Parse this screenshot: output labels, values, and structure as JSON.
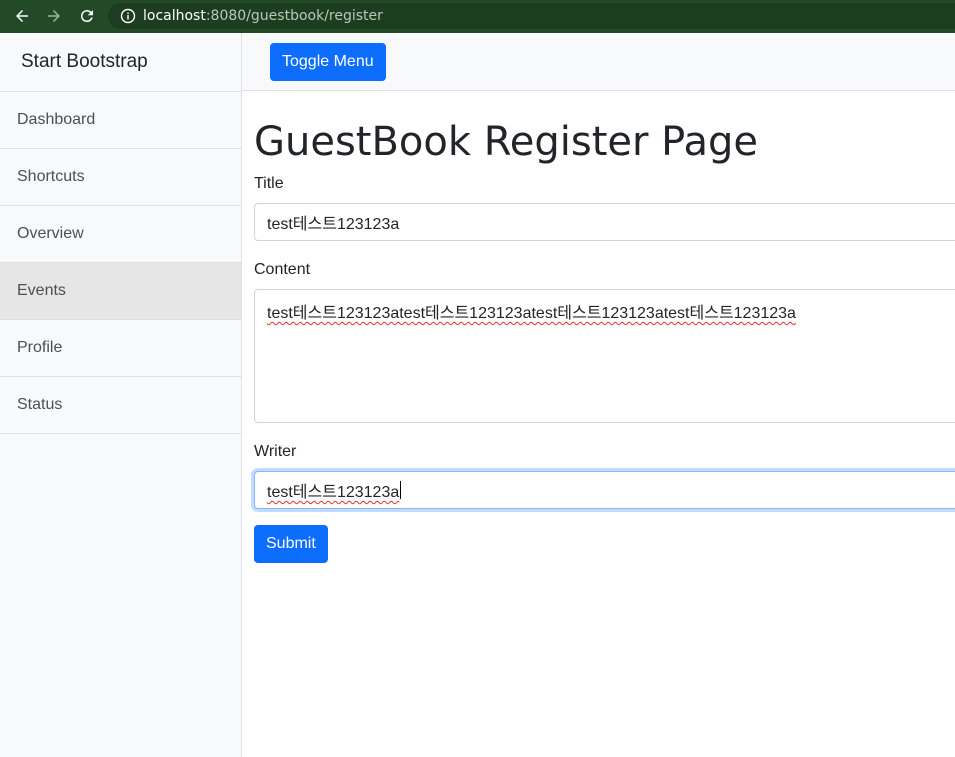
{
  "browser": {
    "url_host": "localhost",
    "url_rest": ":8080/guestbook/register"
  },
  "sidebar": {
    "heading": "Start Bootstrap",
    "items": [
      {
        "label": "Dashboard"
      },
      {
        "label": "Shortcuts"
      },
      {
        "label": "Overview"
      },
      {
        "label": "Events"
      },
      {
        "label": "Profile"
      },
      {
        "label": "Status"
      }
    ],
    "active_item": "Events"
  },
  "topbar": {
    "toggle_label": "Toggle Menu"
  },
  "main": {
    "title": "GuestBook Register Page",
    "title_field": {
      "label": "Title",
      "value": "test테스트123123a"
    },
    "content_field": {
      "label": "Content",
      "value": "test테스트123123atest테스트123123atest테스트123123atest테스트123123a"
    },
    "writer_field": {
      "label": "Writer",
      "value": "test테스트123123a"
    },
    "submit_label": "Submit"
  },
  "colors": {
    "primary": "#0d6efd",
    "browser_chrome": "#234a26",
    "sidebar_bg": "#f8f9fa",
    "active_item_bg": "#e6e6e6"
  }
}
